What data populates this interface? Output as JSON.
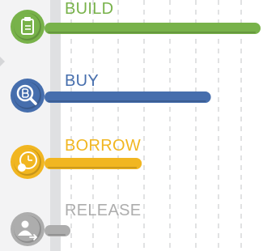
{
  "chart_data": {
    "type": "bar",
    "orientation": "horizontal",
    "categories": [
      "BUILD",
      "BUY",
      "BORROW",
      "RELEASE"
    ],
    "values": [
      100,
      77,
      45,
      12
    ],
    "xlim": [
      0,
      100
    ],
    "grid": true,
    "colors": [
      "#78b24a",
      "#466ead",
      "#f1b621",
      "#adadad"
    ],
    "icons": [
      "clipboard-icon",
      "bitcoin-magnifier-icon",
      "clock-coin-icon",
      "person-exit-icon"
    ]
  }
}
